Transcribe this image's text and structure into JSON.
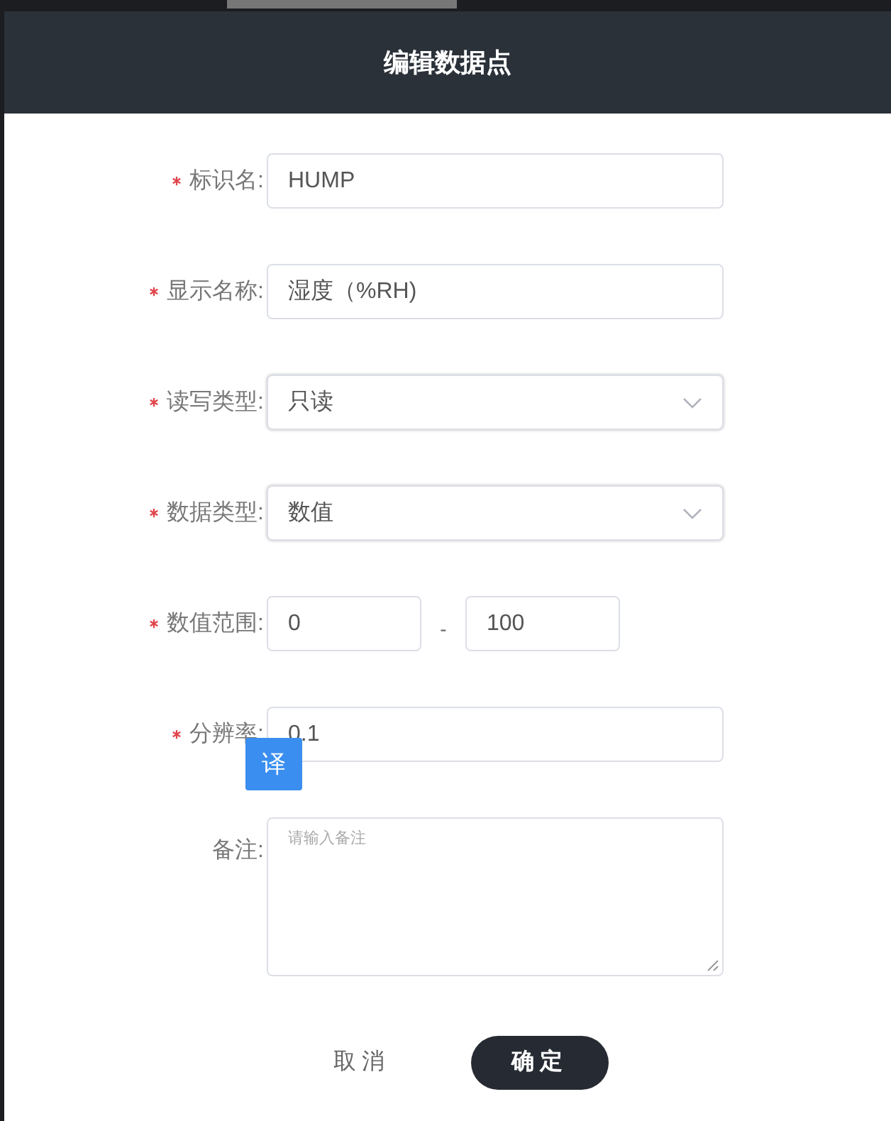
{
  "dialog": {
    "title": "编辑数据点"
  },
  "fields": [
    {
      "kind": "text",
      "label": "标识名:",
      "required": true,
      "value": "HUMP"
    },
    {
      "kind": "text",
      "label": "显示名称:",
      "required": true,
      "value": "湿度（%RH)"
    },
    {
      "kind": "select",
      "label": "读写类型:",
      "required": true,
      "value": "只读"
    },
    {
      "kind": "select",
      "label": "数据类型:",
      "required": true,
      "value": "数值"
    },
    {
      "kind": "range",
      "label": "数值范围:",
      "required": true,
      "min": "0",
      "separator": "-",
      "max": "100"
    },
    {
      "kind": "text",
      "label": "分辨率:",
      "required": true,
      "value": "0.1"
    },
    {
      "kind": "textarea",
      "label": "备注:",
      "required": false,
      "placeholder": "请输入备注"
    }
  ],
  "translate_button": "译",
  "buttons": [
    {
      "kind": "plain",
      "label": "取消"
    },
    {
      "kind": "primary",
      "label": "确定"
    }
  ]
}
